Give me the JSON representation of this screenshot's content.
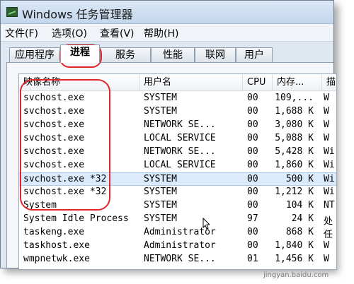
{
  "window": {
    "title": "Windows 任务管理器"
  },
  "menu": {
    "items": [
      "文件(F)",
      "选项(O)",
      "查看(V)",
      "帮助(H)"
    ]
  },
  "tabs": [
    "应用程序",
    "进程",
    "服务",
    "性能",
    "联网",
    "用户"
  ],
  "active_tab": "进程",
  "columns": [
    "映像名称",
    "用户名",
    "CPU",
    "内存...",
    "描"
  ],
  "rows": [
    {
      "name": "svchost.exe",
      "user": "SYSTEM",
      "cpu": "00",
      "mem": "109,...",
      "desc": "W"
    },
    {
      "name": "svchost.exe",
      "user": "SYSTEM",
      "cpu": "00",
      "mem": "1,688 K",
      "desc": "W"
    },
    {
      "name": "svchost.exe",
      "user": "NETWORK SE...",
      "cpu": "00",
      "mem": "3,080 K",
      "desc": "W"
    },
    {
      "name": "svchost.exe",
      "user": "LOCAL SERVICE",
      "cpu": "00",
      "mem": "5,088 K",
      "desc": "W"
    },
    {
      "name": "svchost.exe",
      "user": "NETWORK SE...",
      "cpu": "00",
      "mem": "5,428 K",
      "desc": "Wi"
    },
    {
      "name": "svchost.exe",
      "user": "LOCAL SERVICE",
      "cpu": "00",
      "mem": "1,860 K",
      "desc": "Wi"
    },
    {
      "name": "svchost.exe *32",
      "user": "SYSTEM",
      "cpu": "00",
      "mem": "500 K",
      "desc": "Wi"
    },
    {
      "name": "svchost.exe *32",
      "user": "SYSTEM",
      "cpu": "00",
      "mem": "1,212 K",
      "desc": "Wi"
    },
    {
      "name": "System",
      "user": "SYSTEM",
      "cpu": "00",
      "mem": "104 K",
      "desc": "NT"
    },
    {
      "name": "System Idle Process",
      "user": "SYSTEM",
      "cpu": "97",
      "mem": "24 K",
      "desc": "处"
    },
    {
      "name": "taskeng.exe",
      "user": "Administrator",
      "cpu": "00",
      "mem": "868 K",
      "desc": "任"
    },
    {
      "name": "taskhost.exe",
      "user": "Administrator",
      "cpu": "00",
      "mem": "1,840 K",
      "desc": "W"
    },
    {
      "name": "wmpnetwk.exe",
      "user": "NETWORK SE...",
      "cpu": "01",
      "mem": "1,456 K",
      "desc": "W"
    }
  ],
  "selected_row": 6,
  "watermark": "jingyan.baidu.com",
  "colors": {
    "highlight": "#e0262b",
    "selection": "#dcebfc"
  },
  "icons": {
    "app": "task-manager-icon",
    "pointer": "mouse-pointer-icon"
  }
}
